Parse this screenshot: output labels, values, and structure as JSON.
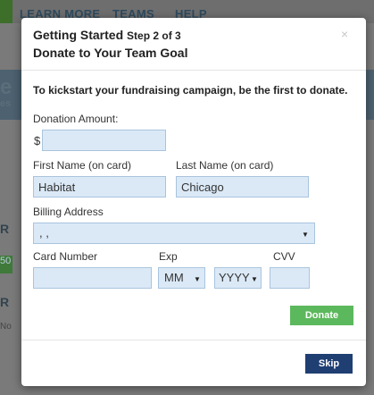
{
  "background": {
    "nav_items": [
      "LEARN MORE",
      "TEAMS",
      "HELP"
    ],
    "side_letters": [
      "e",
      "es",
      "R",
      "R",
      "No",
      "50"
    ]
  },
  "modal": {
    "title": "Getting Started",
    "step": "Step 2 of 3",
    "subtitle": "Donate to Your Team Goal",
    "close_symbol": "×",
    "intro": "To kickstart your fundraising campaign, be the first to donate.",
    "donation": {
      "label": "Donation Amount:",
      "currency": "$",
      "value": ""
    },
    "first_name": {
      "label": "First Name (on card)",
      "value": "Habitat"
    },
    "last_name": {
      "label": "Last Name (on card)",
      "value": "Chicago"
    },
    "billing": {
      "label": "Billing Address",
      "value": ", ,"
    },
    "card_number": {
      "label": "Card Number",
      "value": ""
    },
    "exp": {
      "label": "Exp",
      "month": "MM",
      "year": "YYYY"
    },
    "cvv": {
      "label": "CVV",
      "value": ""
    },
    "donate_label": "Donate",
    "skip_label": "Skip"
  },
  "colors": {
    "field_bg": "#dbe9f7",
    "donate": "#5cb85c",
    "skip": "#1f3f73"
  }
}
